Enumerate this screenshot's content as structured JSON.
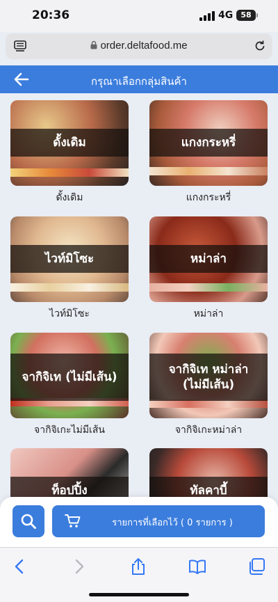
{
  "status_bar": {
    "time": "20:36",
    "network": "4G",
    "battery": "58"
  },
  "browser": {
    "url": "order.deltafood.me"
  },
  "header": {
    "title": "กรุณาเลือกกลุ่มสินค้า"
  },
  "categories": [
    {
      "banner": "ดั้งเดิม",
      "label": "ดั้งเดิม"
    },
    {
      "banner": "แกงกระหรี่",
      "label": "แกงกระหรี่"
    },
    {
      "banner": "ไวท์มิโซะ",
      "label": "ไวท์มิโซะ"
    },
    {
      "banner": "หม่าล่า",
      "label": "หม่าล่า"
    },
    {
      "banner": "จากิจิเท (ไม่มีเส้น)",
      "label": "จากิจิเกะไม่มีเส้น"
    },
    {
      "banner": "จากิจิเท หม่าล่า (ไม่มีเส้น)",
      "label": "จากิจิเกะหม่าล่า"
    },
    {
      "banner": "ท็อปปิ้ง",
      "label": ""
    },
    {
      "banner": "ทัลคาบี้",
      "label": ""
    }
  ],
  "actions": {
    "cart_label": "รายการที่เลือกไว้ ( 0 รายการ )"
  },
  "icons": {
    "back": "arrow-left-icon",
    "search": "search-icon",
    "cart": "cart-icon",
    "lock": "lock-icon",
    "reload": "reload-icon",
    "menu": "reader-icon",
    "share": "share-icon",
    "bookmarks": "book-icon",
    "tabs": "tabs-icon"
  },
  "colors": {
    "primary": "#3b7ddd",
    "background": "#e9edf4"
  }
}
